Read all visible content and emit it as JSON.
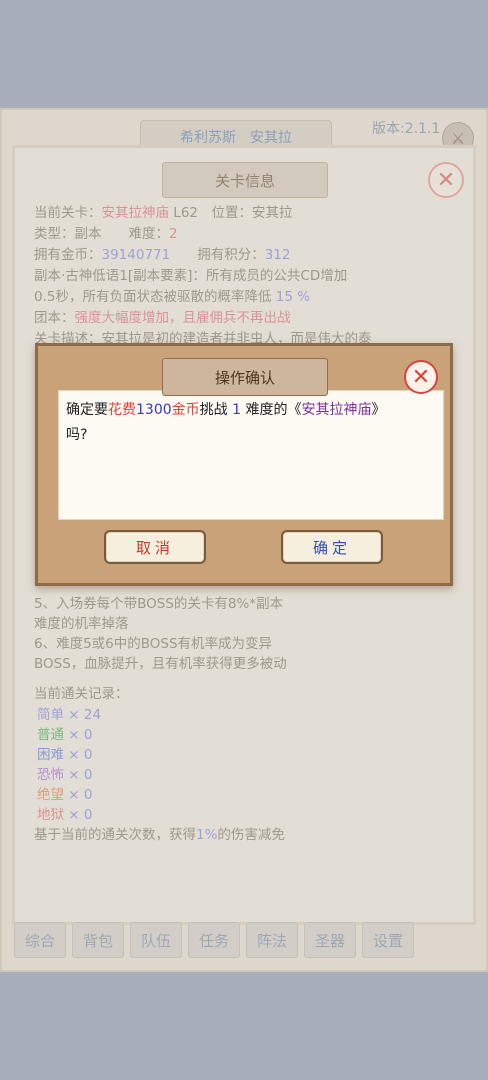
{
  "header": {
    "tab_label": "希利苏斯　安其拉",
    "version": "版本:2.1.1",
    "corner_icon": "swords-icon"
  },
  "panel": {
    "title": "关卡信息",
    "close_icon": "close-icon",
    "lines": [
      {
        "label": "当前关卡：",
        "value": "安其拉神庙",
        "rest": " L62　位置：安其拉"
      },
      {
        "label": "类型：副本　　难度：",
        "value": "2",
        "rest": ""
      },
      {
        "label": "拥有金币：",
        "value": "39140771",
        "rest": "　　拥有积分：",
        "value2": "312"
      },
      {
        "label": "副本·古神低语1[副本要素]：所有成员的公共CD增加",
        "value": "",
        "rest": ""
      },
      {
        "label": "0.5秒，所有负面状态被驱散的概率降低 ",
        "value": "15 %",
        "rest": ""
      },
      {
        "label": "团本：",
        "value": "强度大幅度增加，且雇佣兵不再出战",
        "rest": ""
      },
      {
        "label": "关卡描述：安其拉是初的建造者并非虫人，而是伟大的泰",
        "value": "",
        "rest": ""
      }
    ],
    "desc_lines": [
      "5、入场券每个带BOSS的关卡有8%*副本",
      "难度的机率掉落",
      "6、难度5或6中的BOSS有机率成为变异",
      "BOSS，血脉提升，且有机率获得更多被动"
    ],
    "records_title": "当前通关记录：",
    "records": [
      {
        "name": "简单",
        "count": "× 24",
        "color": "#8d8fe3"
      },
      {
        "name": "普通",
        "count": "× 0",
        "color": "#54b36a"
      },
      {
        "name": "困难",
        "count": "× 0",
        "color": "#6a86e0"
      },
      {
        "name": "恐怖",
        "count": "× 0",
        "color": "#b07ad6"
      },
      {
        "name": "绝望",
        "count": "× 0",
        "color": "#e58a5c"
      },
      {
        "name": "地狱",
        "count": "× 0",
        "color": "#e07b86"
      }
    ],
    "bonus_pre": "基于当前的通关次数，获得",
    "bonus_value": "1%",
    "bonus_post": "的伤害减免"
  },
  "bottom_nav": [
    "综合",
    "背包",
    "队伍",
    "任务",
    "阵法",
    "圣器",
    "设置"
  ],
  "modal": {
    "title": "操作确认",
    "close_icon": "close-icon",
    "msg_1": "确定要",
    "msg_2": "花费",
    "msg_3": "1300",
    "msg_4": "金币",
    "msg_5": "挑战 ",
    "msg_6": "1",
    "msg_7": " 难度的《",
    "msg_8": "安其拉神庙",
    "msg_9": "》吗?",
    "cancel_label": "取消",
    "ok_label": "确定"
  },
  "colors": {
    "modal_bg": "#c9a27a",
    "accent_red": "#e2413a",
    "accent_blue": "#3438c8"
  }
}
